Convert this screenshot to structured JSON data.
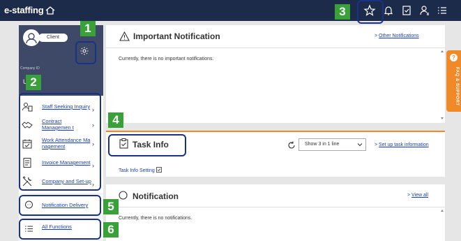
{
  "app": {
    "logo": "e-staffing"
  },
  "sidebar": {
    "client_label": "Client",
    "company_id_label": "Company ID",
    "user_name": "User",
    "menu": [
      {
        "label": "Staff Seeking Inquiry",
        "icon": "staff-inquiry-icon"
      },
      {
        "label": "Contract Managemen t",
        "icon": "handshake-icon"
      },
      {
        "label": "Work Attendance Ma nagement",
        "icon": "attendance-calendar-icon"
      },
      {
        "label": "Invoice Management",
        "icon": "invoice-icon"
      },
      {
        "label": "Company and Set-up",
        "icon": "tools-icon"
      }
    ],
    "notification_delivery": "Notification Delivery",
    "all_functions": "All Functions"
  },
  "important_notification": {
    "title": "Important Notification",
    "link": "Other Notifications",
    "body": "Currently, there is no important notifications."
  },
  "task_info": {
    "title": "Task Info",
    "select_value": "Show 3 in 1 line",
    "link": "Set up task information",
    "setting_label": "Task Info Setting"
  },
  "notification": {
    "title": "Notification",
    "link": "View all",
    "body": "Currently, there is no notifications."
  },
  "faq": {
    "label": "FAQ & SUPPORT",
    "q": "?"
  },
  "callouts": [
    "1",
    "2",
    "3",
    "4",
    "5",
    "6"
  ],
  "colors": {
    "topbar": "#1d2b4a",
    "client_panel": "#3e4867",
    "link": "#1b3fa8",
    "accent_orange": "#f08a29",
    "callout_green": "#3aa13a",
    "highlight_navy": "#1a3285"
  }
}
